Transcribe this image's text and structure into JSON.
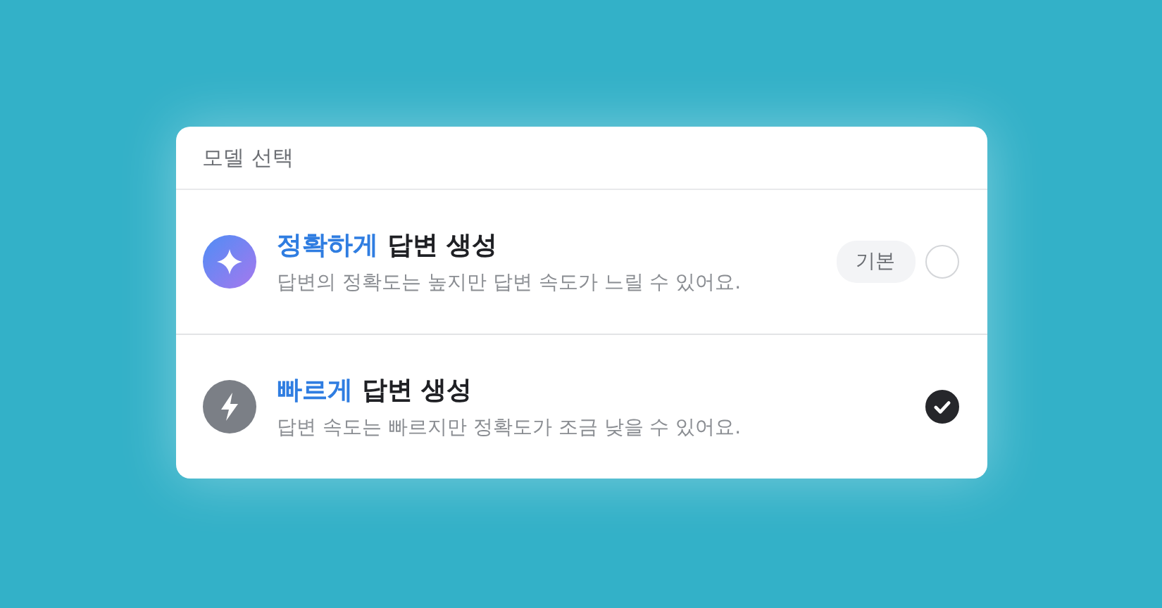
{
  "panel": {
    "title": "모델 선택"
  },
  "options": [
    {
      "kind": "sparkle",
      "accent": "정확하게",
      "title": "답변 생성",
      "description": "답변의 정확도는 높지만 답변 속도가 느릴 수 있어요.",
      "badge": "기본",
      "selected": false
    },
    {
      "kind": "bolt",
      "accent": "빠르게",
      "title": "답변 생성",
      "description": "답변 속도는 빠르지만 정확도가 조금 낮을 수 있어요.",
      "selected": true
    }
  ]
}
